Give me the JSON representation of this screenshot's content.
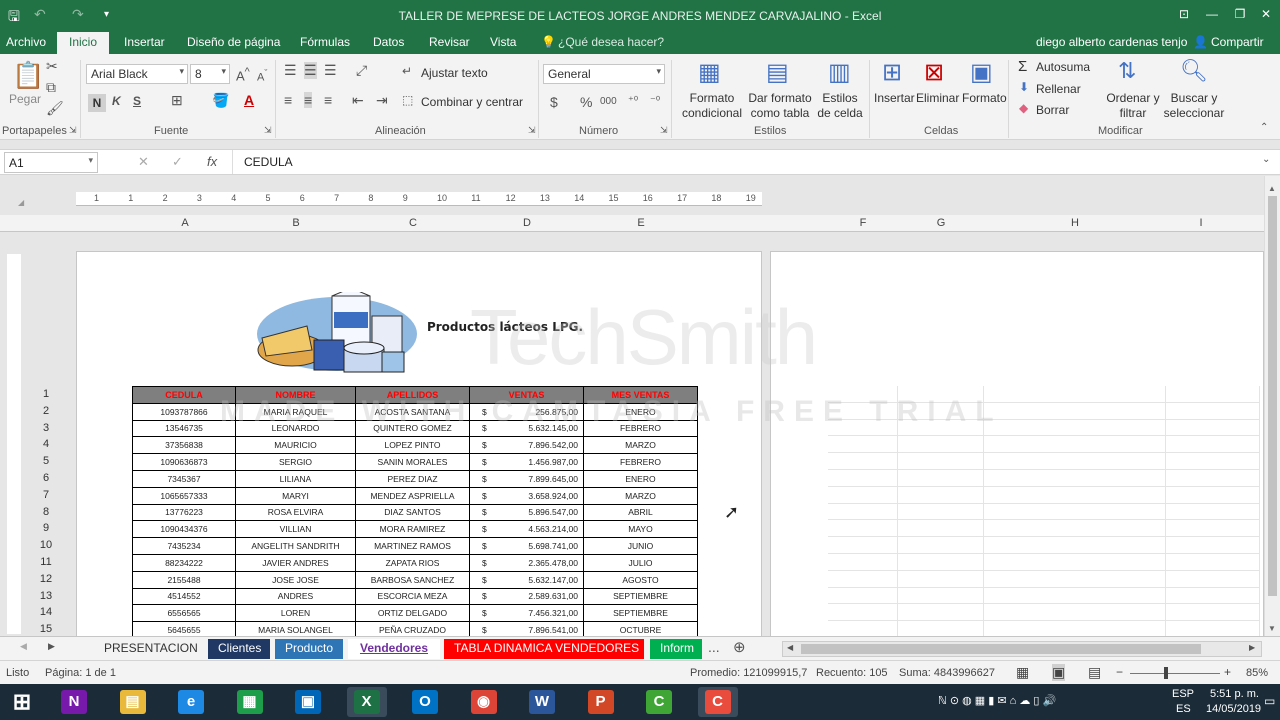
{
  "window": {
    "title": "TALLER DE MEPRESE DE LACTEOS JORGE ANDRES MENDEZ CARVAJALINO - Excel",
    "minimize": "—",
    "restore": "❐",
    "close": "✕",
    "ribbon_display": "⊡"
  },
  "tabs": [
    "Archivo",
    "Inicio",
    "Insertar",
    "Diseño de página",
    "Fórmulas",
    "Datos",
    "Revisar",
    "Vista"
  ],
  "active_tab": "Inicio",
  "tell_me": "¿Qué desea hacer?",
  "user": "diego alberto cardenas tenjo",
  "share": "Compartir",
  "ribbon": {
    "clipboard": {
      "paste": "Pegar",
      "label": "Portapapeles"
    },
    "font": {
      "name": "Arial Black",
      "size": "8",
      "bold": "N",
      "italic": "K",
      "underline": "S",
      "label": "Fuente"
    },
    "alignment": {
      "wrap": "Ajustar texto",
      "merge": "Combinar y centrar",
      "label": "Alineación"
    },
    "number": {
      "format": "General",
      "currency": "$",
      "percent": "%",
      "thousands": "000",
      "label": "Número"
    },
    "styles": {
      "conditional": "Formato condicional",
      "table": "Dar formato como tabla",
      "cell": "Estilos de celda",
      "label": "Estilos"
    },
    "cells": {
      "insert": "Insertar",
      "delete": "Eliminar",
      "format": "Formato",
      "label": "Celdas"
    },
    "editing": {
      "autosum": "Autosuma",
      "fill": "Rellenar",
      "clear": "Borrar",
      "sort": "Ordenar y filtrar",
      "find": "Buscar y seleccionar",
      "label": "Modificar"
    }
  },
  "formula_bar": {
    "cell": "A1",
    "content": "CEDULA"
  },
  "columns": [
    "A",
    "B",
    "C",
    "D",
    "E",
    "F",
    "G",
    "H",
    "I"
  ],
  "ruler_numbers": [
    "1",
    "1",
    "2",
    "3",
    "4",
    "5",
    "6",
    "7",
    "8",
    "9",
    "10",
    "11",
    "12",
    "13",
    "14",
    "15",
    "16",
    "17",
    "18",
    "19"
  ],
  "logo_text": "Productos lácteos LPG.",
  "watermark": {
    "line1": "TechSmith",
    "line2": "MADE WITH CAMTASIA FREE TRIAL"
  },
  "table": {
    "headers": [
      "CEDULA",
      "NOMBRE",
      "APELLIDOS",
      "VENTAS",
      "MES VENTAS"
    ],
    "rows": [
      [
        "1093787866",
        "MARIA RAQUEL",
        "ACOSTA SANTANA",
        "$",
        "256.875,00",
        "ENERO"
      ],
      [
        "13546735",
        "LEONARDO",
        "QUINTERO GOMEZ",
        "$",
        "5.632.145,00",
        "FEBRERO"
      ],
      [
        "37356838",
        "MAURICIO",
        "LOPEZ PINTO",
        "$",
        "7.896.542,00",
        "MARZO"
      ],
      [
        "1090636873",
        "SERGIO",
        "SANIN MORALES",
        "$",
        "1.456.987,00",
        "FEBRERO"
      ],
      [
        "7345367",
        "LILIANA",
        "PEREZ DIAZ",
        "$",
        "7.899.645,00",
        "ENERO"
      ],
      [
        "1065657333",
        "MARYI",
        "MENDEZ ASPRIELLA",
        "$",
        "3.658.924,00",
        "MARZO"
      ],
      [
        "13776223",
        "ROSA ELVIRA",
        "DIAZ SANTOS",
        "$",
        "5.896.547,00",
        "ABRIL"
      ],
      [
        "1090434376",
        "VILLIAN",
        "MORA RAMIREZ",
        "$",
        "4.563.214,00",
        "MAYO"
      ],
      [
        "7435234",
        "ANGELITH SANDRITH",
        "MARTINEZ RAMOS",
        "$",
        "5.698.741,00",
        "JUNIO"
      ],
      [
        "88234222",
        "JAVIER ANDRES",
        "ZAPATA RIOS",
        "$",
        "2.365.478,00",
        "JULIO"
      ],
      [
        "2155488",
        "JOSE JOSE",
        "BARBOSA SANCHEZ",
        "$",
        "5.632.147,00",
        "AGOSTO"
      ],
      [
        "4514552",
        "ANDRES",
        "ESCORCIA MEZA",
        "$",
        "2.589.631,00",
        "SEPTIEMBRE"
      ],
      [
        "6556565",
        "LOREN",
        "ORTIZ DELGADO",
        "$",
        "7.456.321,00",
        "SEPTIEMBRE"
      ],
      [
        "5645655",
        "MARIA SOLANGEL",
        "PEÑA CRUZADO",
        "$",
        "7.896.541,00",
        "OCTUBRE"
      ]
    ]
  },
  "row_numbers": [
    "1",
    "2",
    "3",
    "4",
    "5",
    "6",
    "7",
    "8",
    "9",
    "10",
    "11",
    "12",
    "13",
    "14",
    "15"
  ],
  "sheet_tabs": [
    {
      "label": "PRESENTACION",
      "bg": "#f3f3f3",
      "fg": "#333333"
    },
    {
      "label": "Clientes",
      "bg": "#1f3864",
      "fg": "#ffffff"
    },
    {
      "label": "Producto",
      "bg": "#2e75b6",
      "fg": "#ffffff"
    },
    {
      "label": "Vendedores",
      "bg": "#ffffff",
      "fg": "#7030a0"
    },
    {
      "label": "TABLA DINAMICA VENDEDORES",
      "bg": "#ff0000",
      "fg": "#ffffff"
    },
    {
      "label": "Inform",
      "bg": "#00b050",
      "fg": "#ffffff"
    }
  ],
  "sheet_more": "...",
  "status": {
    "mode": "Listo",
    "page": "Página: 1 de 1",
    "average": "Promedio: 121099915,7",
    "count": "Recuento: 105",
    "sum": "Suma: 4843996627",
    "zoom": "85%"
  },
  "taskbar": {
    "lang1": "ESP",
    "lang2": "ES",
    "time": "5:51 p. m.",
    "date": "14/05/2019",
    "apps": [
      {
        "glyph": "N",
        "color": "#7719aa",
        "icon": "onenote-icon"
      },
      {
        "glyph": "▤",
        "color": "#e8b93b",
        "icon": "file-explorer-icon"
      },
      {
        "glyph": "e",
        "color": "#1e88e5",
        "icon": "internet-explorer-icon"
      },
      {
        "glyph": "▦",
        "color": "#1e9e4a",
        "icon": "store-icon"
      },
      {
        "glyph": "▣",
        "color": "#0067b8",
        "icon": "remote-icon"
      },
      {
        "glyph": "X",
        "color": "#1e7145",
        "icon": "excel-icon"
      },
      {
        "glyph": "O",
        "color": "#0072c6",
        "icon": "outlook-icon"
      },
      {
        "glyph": "◉",
        "color": "#db4437",
        "icon": "chrome-icon"
      },
      {
        "glyph": "W",
        "color": "#2b579a",
        "icon": "word-icon"
      },
      {
        "glyph": "P",
        "color": "#d24726",
        "icon": "powerpoint-icon"
      },
      {
        "glyph": "C",
        "color": "#3fa535",
        "icon": "camtasia-green-icon"
      },
      {
        "glyph": "C",
        "color": "#e94b3c",
        "icon": "camtasia-red-icon"
      }
    ]
  },
  "colors": {
    "excel_green": "#217346",
    "header_fill": "#7f7f7f",
    "header_text": "#ff0000"
  }
}
